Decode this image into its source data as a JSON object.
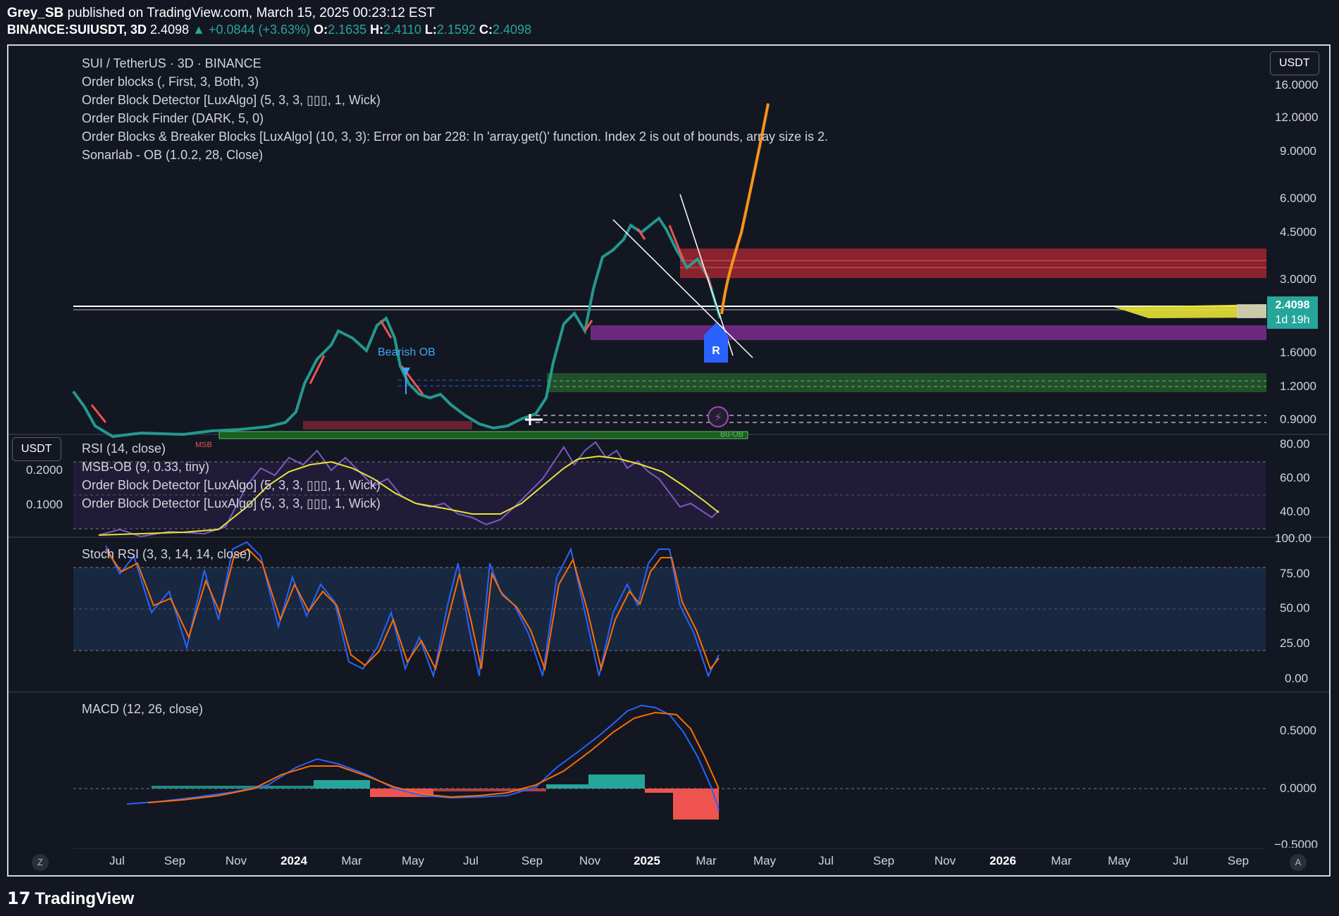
{
  "header": {
    "author": "Grey_SB",
    "published": "published on TradingView.com, March 15, 2025 00:23:12 EST",
    "symbol": "BINANCE:SUIUSDT, 3D",
    "last": "2.4098",
    "change": "+0.0844 (+3.63%)",
    "o_label": "O:",
    "o_value": "2.1635",
    "h_label": "H:",
    "h_value": "2.4110",
    "l_label": "L:",
    "l_value": "2.1592",
    "c_label": "C:",
    "c_value": "2.4098"
  },
  "main_pane": {
    "currency_button": "USDT",
    "legend": [
      "SUI / TetherUS · 3D · BINANCE",
      "Order blocks (, First, 3, Both, 3)",
      "Order Block Detector [LuxAlgo] (5, 3, 3, ▯▯▯, 1, Wick)",
      "Order Block Finder (DARK, 5, 0)",
      "Order Blocks & Breaker Blocks [LuxAlgo] (10, 3, 3): Error on bar 228: In 'array.get()' function. Index 2 is out of bounds, array size is 2.",
      "Sonarlab - OB (1.0.2, 28, Close)"
    ],
    "price_axis": [
      "16.0000",
      "12.0000",
      "9.0000",
      "6.0000",
      "4.5000",
      "3.0000",
      "1.6000",
      "1.2000",
      "0.9000"
    ],
    "last_price_tag": "2.4098",
    "countdown": "1d 19h",
    "bearish_ob_label": "Bearish OB",
    "r_marker": "R",
    "msb_label": "MSB",
    "bu_ob_label": "Bu-OB"
  },
  "rsi_pane": {
    "currency_button": "USDT",
    "left_axis": [
      "0.2000",
      "0.1000"
    ],
    "legend": [
      "RSI (14, close)",
      "MSB-OB (9, 0.33, tiny)",
      "Order Block Detector [LuxAlgo] (5, 3, 3, ▯▯▯, 1, Wick)",
      "Order Block Detector [LuxAlgo] (5, 3, 3, ▯▯▯, 1, Wick)"
    ],
    "axis": [
      "80.00",
      "60.00",
      "40.00"
    ]
  },
  "stoch_pane": {
    "legend": "Stoch RSI (3, 3, 14, 14, close)",
    "axis": [
      "100.00",
      "75.00",
      "50.00",
      "25.00",
      "0.00"
    ]
  },
  "macd_pane": {
    "legend": "MACD (12, 26, close)",
    "axis": [
      "0.5000",
      "0.0000",
      "−0.5000"
    ]
  },
  "time_axis": [
    {
      "label": "Jul",
      "bold": false
    },
    {
      "label": "Sep",
      "bold": false
    },
    {
      "label": "Nov",
      "bold": false
    },
    {
      "label": "2024",
      "bold": true
    },
    {
      "label": "Mar",
      "bold": false
    },
    {
      "label": "May",
      "bold": false
    },
    {
      "label": "Jul",
      "bold": false
    },
    {
      "label": "Sep",
      "bold": false
    },
    {
      "label": "Nov",
      "bold": false
    },
    {
      "label": "2025",
      "bold": true
    },
    {
      "label": "Mar",
      "bold": false
    },
    {
      "label": "May",
      "bold": false
    },
    {
      "label": "Jul",
      "bold": false
    },
    {
      "label": "Sep",
      "bold": false
    },
    {
      "label": "Nov",
      "bold": false
    },
    {
      "label": "2026",
      "bold": true
    },
    {
      "label": "Mar",
      "bold": false
    },
    {
      "label": "May",
      "bold": false
    },
    {
      "label": "Jul",
      "bold": false
    },
    {
      "label": "Sep",
      "bold": false
    }
  ],
  "corner_buttons": {
    "left": "Z",
    "right": "A"
  },
  "branding": "TradingView",
  "colors": {
    "background": "#131722",
    "up": "#26a69a",
    "down": "#ef5350",
    "rsi": "#7e57c2",
    "rsi_ma": "#e8e337",
    "macd": "#2962ff",
    "signal": "#ff6d00",
    "projection": "#f7931a"
  }
}
